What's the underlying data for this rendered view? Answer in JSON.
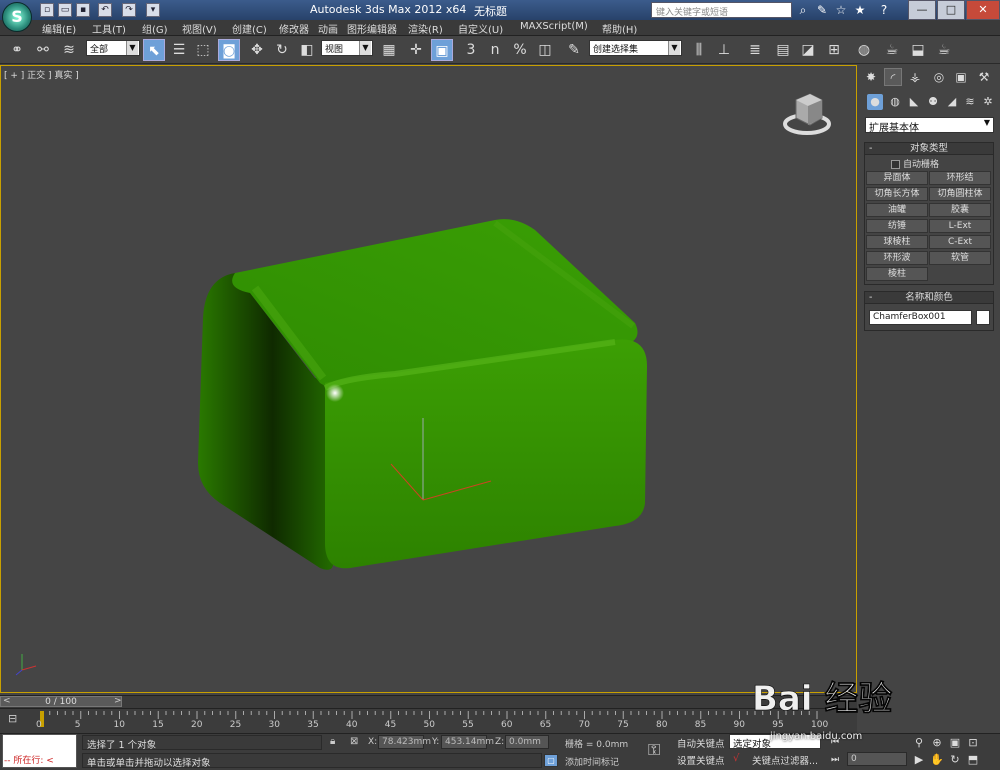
{
  "titlebar": {
    "title": "Autodesk 3ds Max  2012 x64",
    "document": "无标题",
    "search_placeholder": "键入关键字或短语",
    "win_min": "—",
    "win_max": "□",
    "win_close": "✕"
  },
  "menu": {
    "items": [
      "编辑(E)",
      "工具(T)",
      "组(G)",
      "视图(V)",
      "创建(C)",
      "修改器",
      "动画",
      "图形编辑器",
      "渲染(R)",
      "自定义(U)",
      "MAXScript(M)",
      "帮助(H)"
    ]
  },
  "toolbar": {
    "selection_filter": "全部",
    "ref_coord": "视图",
    "named_selection": "创建选择集",
    "snap_3": "3",
    "snap_percent": "%",
    "snap_angle": "n"
  },
  "viewport": {
    "label": "[ + ] 正交 ] 真实 ]",
    "object_color": "#3c9a06",
    "border_color": "#c8a000"
  },
  "command_panel": {
    "category": "扩展基本体",
    "object_type": {
      "title": "对象类型",
      "auto_grid": "自动栅格",
      "buttons": [
        "异面体",
        "环形结",
        "切角长方体",
        "切角圆柱体",
        "油罐",
        "胶囊",
        "纺锤",
        "L-Ext",
        "球棱柱",
        "C-Ext",
        "环形波",
        "软管",
        "棱柱"
      ]
    },
    "name_color": {
      "title": "名称和颜色",
      "name": "ChamferBox001",
      "color": "#ffffff"
    }
  },
  "timeline": {
    "position": "0 / 100",
    "ticks": [
      "0",
      "5",
      "10",
      "15",
      "20",
      "25",
      "30",
      "35",
      "40",
      "45",
      "50",
      "55",
      "60",
      "65",
      "70",
      "75",
      "80",
      "85",
      "90",
      "95",
      "100"
    ]
  },
  "status": {
    "maxscript_label": "所在行:",
    "selection": "选择了 1 个对象",
    "prompt": "单击或单击并拖动以选择对象",
    "x_label": "X:",
    "x_value": "78.423mm",
    "y_label": "Y:",
    "y_value": "453.14mm",
    "z_label": "Z:",
    "z_value": "0.0mm",
    "grid": "栅格 = 0.0mm",
    "add_time_tag": "添加时间标记",
    "auto_key": "自动关键点",
    "set_key": "设置关键点",
    "selected": "选定对象",
    "key_filters": "关键点过滤器...",
    "frame": "0"
  },
  "watermark": {
    "brand_text": "Bai 经验",
    "url": "jingyan.baidu.com"
  }
}
